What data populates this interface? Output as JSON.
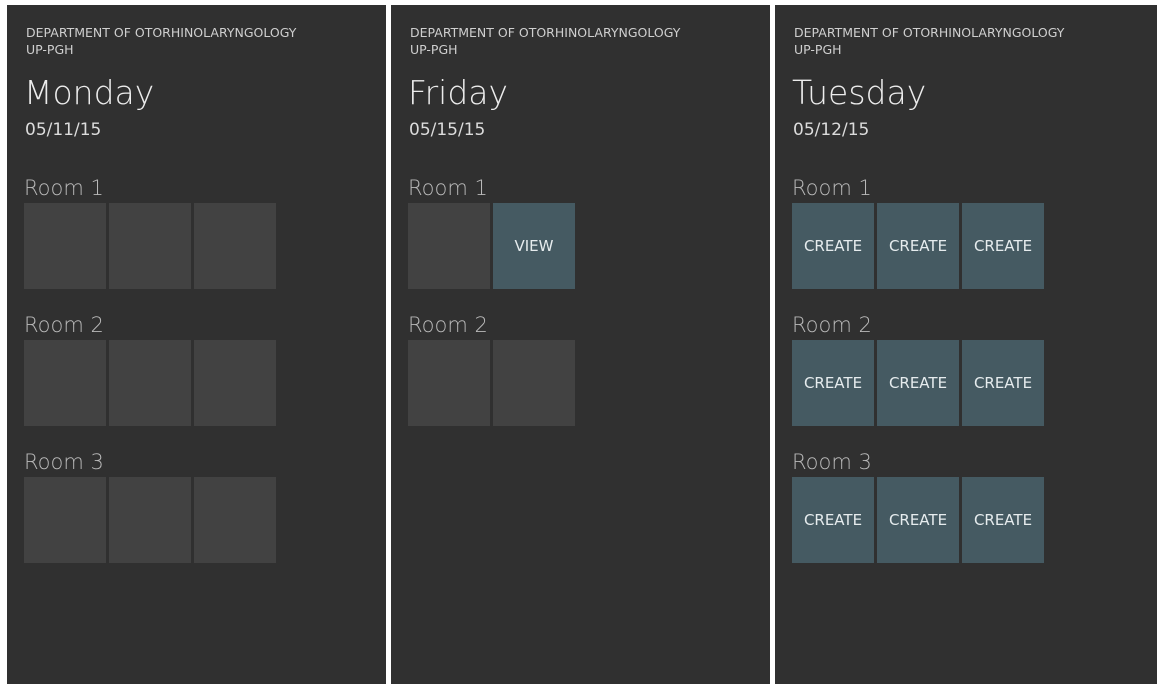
{
  "department": {
    "line1": "DEPARTMENT OF OTORHINOLARYNGOLOGY",
    "line2": "UP-PGH"
  },
  "colors": {
    "screen_bg": "#303030",
    "empty_slot": "#424242",
    "action_slot": "#455A62",
    "separator": "#FFFFFF"
  },
  "screens": [
    {
      "day": "Monday",
      "date": "05/11/15",
      "rooms": [
        {
          "label": "Room 1",
          "slots": [
            "",
            "",
            ""
          ]
        },
        {
          "label": "Room 2",
          "slots": [
            "",
            "",
            ""
          ]
        },
        {
          "label": "Room 3",
          "slots": [
            "",
            "",
            ""
          ]
        }
      ]
    },
    {
      "day": "Friday",
      "date": "05/15/15",
      "rooms": [
        {
          "label": "Room 1",
          "slots": [
            "",
            "VIEW"
          ]
        },
        {
          "label": "Room 2",
          "slots": [
            "",
            ""
          ]
        }
      ]
    },
    {
      "day": "Tuesday",
      "date": "05/12/15",
      "rooms": [
        {
          "label": "Room 1",
          "slots": [
            "CREATE",
            "CREATE",
            "CREATE"
          ]
        },
        {
          "label": "Room 2",
          "slots": [
            "CREATE",
            "CREATE",
            "CREATE"
          ]
        },
        {
          "label": "Room 3",
          "slots": [
            "CREATE",
            "CREATE",
            "CREATE"
          ]
        }
      ]
    }
  ]
}
